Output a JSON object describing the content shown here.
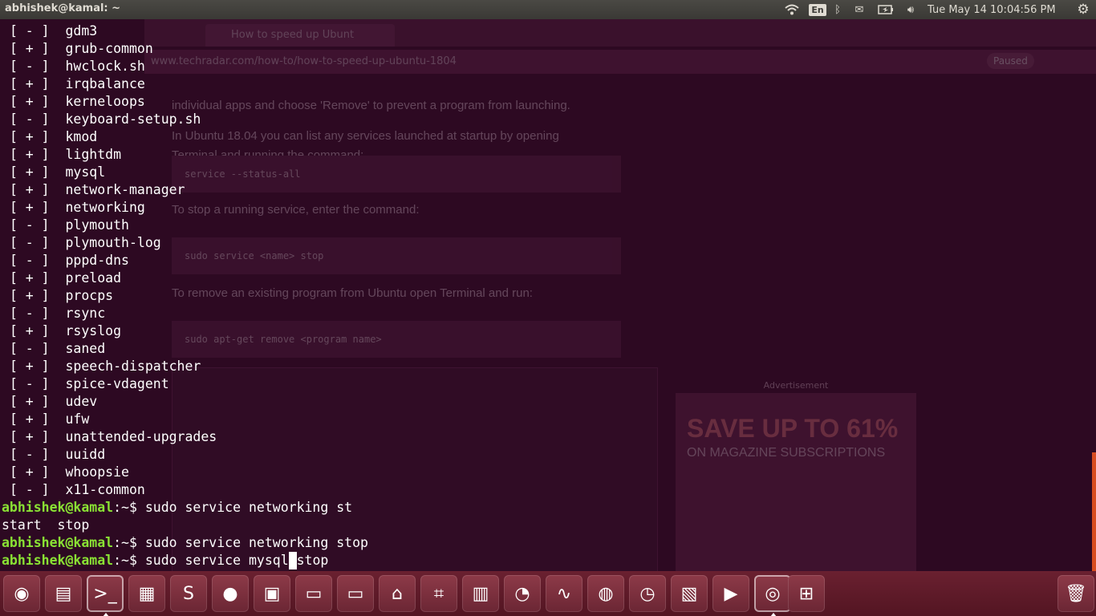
{
  "top_panel": {
    "window_title": "abhishek@kamal: ~",
    "keyboard_layout": "En",
    "clock": "Tue May 14   10:04:56 PM",
    "icons": [
      "wifi-icon",
      "keyboard-layout-icon",
      "bluetooth-icon",
      "mail-icon",
      "battery-icon",
      "volume-icon",
      "settings-gear-icon"
    ]
  },
  "background_browser": {
    "tab_title": "How to speed up Ubunt",
    "url": "www.techradar.com/how-to/how-to-speed-up-ubuntu-1804",
    "status": "Paused",
    "article_lines": [
      "individual apps and choose 'Remove' to prevent a program from launching.",
      "In Ubuntu 18.04 you can list any services launched at startup by opening",
      "Terminal and running the command:"
    ],
    "code1": "service --status-all",
    "stop_text": "To stop a running service, enter the command:",
    "code2": "sudo service <name> stop",
    "remove_text": "To remove an existing program from Ubuntu open Terminal and run:",
    "code3": "sudo apt-get remove <program name>",
    "ad_label": "Advertisement",
    "ad_headline": "SAVE UP TO 61%",
    "ad_sub": "ON MAGAZINE SUBSCRIPTIONS"
  },
  "terminal": {
    "services": [
      {
        "status": "[ - ]",
        "name": "gdm3"
      },
      {
        "status": "[ + ]",
        "name": "grub-common"
      },
      {
        "status": "[ - ]",
        "name": "hwclock.sh"
      },
      {
        "status": "[ + ]",
        "name": "irqbalance"
      },
      {
        "status": "[ + ]",
        "name": "kerneloops"
      },
      {
        "status": "[ - ]",
        "name": "keyboard-setup.sh"
      },
      {
        "status": "[ + ]",
        "name": "kmod"
      },
      {
        "status": "[ + ]",
        "name": "lightdm"
      },
      {
        "status": "[ + ]",
        "name": "mysql"
      },
      {
        "status": "[ + ]",
        "name": "network-manager"
      },
      {
        "status": "[ + ]",
        "name": "networking"
      },
      {
        "status": "[ - ]",
        "name": "plymouth"
      },
      {
        "status": "[ - ]",
        "name": "plymouth-log"
      },
      {
        "status": "[ - ]",
        "name": "pppd-dns"
      },
      {
        "status": "[ + ]",
        "name": "preload"
      },
      {
        "status": "[ + ]",
        "name": "procps"
      },
      {
        "status": "[ - ]",
        "name": "rsync"
      },
      {
        "status": "[ + ]",
        "name": "rsyslog"
      },
      {
        "status": "[ - ]",
        "name": "saned"
      },
      {
        "status": "[ + ]",
        "name": "speech-dispatcher"
      },
      {
        "status": "[ - ]",
        "name": "spice-vdagent"
      },
      {
        "status": "[ + ]",
        "name": "udev"
      },
      {
        "status": "[ + ]",
        "name": "ufw"
      },
      {
        "status": "[ + ]",
        "name": "unattended-upgrades"
      },
      {
        "status": "[ - ]",
        "name": "uuidd"
      },
      {
        "status": "[ + ]",
        "name": "whoopsie"
      },
      {
        "status": "[ - ]",
        "name": "x11-common"
      }
    ],
    "prompt_user": "abhishek@kamal",
    "prompt_sep": ":",
    "prompt_path": "~$",
    "cmd1": " sudo service networking st",
    "completion": "start  stop",
    "cmd2": " sudo service networking stop",
    "cmd3_before_cursor": " sudo service mysql",
    "cmd3_cursor_char": " ",
    "cmd3_after_cursor": "stop"
  },
  "launcher": {
    "items": [
      {
        "name": "ubuntu-dash-icon",
        "glyph": "◉",
        "active": false
      },
      {
        "name": "files-icon",
        "glyph": "▤",
        "active": false
      },
      {
        "name": "terminal-icon",
        "glyph": ">_",
        "active": true
      },
      {
        "name": "screen-recorder-icon",
        "glyph": "▦",
        "active": false
      },
      {
        "name": "sublime-text-icon",
        "glyph": "S",
        "active": false
      },
      {
        "name": "firefox-icon",
        "glyph": "●",
        "active": false
      },
      {
        "name": "virtualbox-icon",
        "glyph": "▣",
        "active": false
      },
      {
        "name": "drive-icon",
        "glyph": "▭",
        "active": false
      },
      {
        "name": "drive-2-icon",
        "glyph": "▭",
        "active": false
      },
      {
        "name": "software-center-icon",
        "glyph": "⌂",
        "active": false
      },
      {
        "name": "screenshot-crop-icon",
        "glyph": "⌗",
        "active": false
      },
      {
        "name": "window-app-icon",
        "glyph": "▥",
        "active": false
      },
      {
        "name": "disk-usage-icon",
        "glyph": "◔",
        "active": false
      },
      {
        "name": "system-monitor-icon",
        "glyph": "∿",
        "active": false
      },
      {
        "name": "unetbootin-icon",
        "glyph": "◍",
        "active": false
      },
      {
        "name": "clock-icon",
        "glyph": "◷",
        "active": false
      },
      {
        "name": "video-editor-icon",
        "glyph": "▧",
        "active": false
      },
      {
        "name": "media-player-icon",
        "glyph": "▶",
        "active": false
      },
      {
        "name": "chrome-icon",
        "glyph": "◎",
        "active": true
      },
      {
        "name": "workspace-switcher-icon",
        "glyph": "⊞",
        "active": false
      },
      {
        "name": "trash-icon",
        "glyph": "🗑",
        "active": false
      }
    ]
  }
}
